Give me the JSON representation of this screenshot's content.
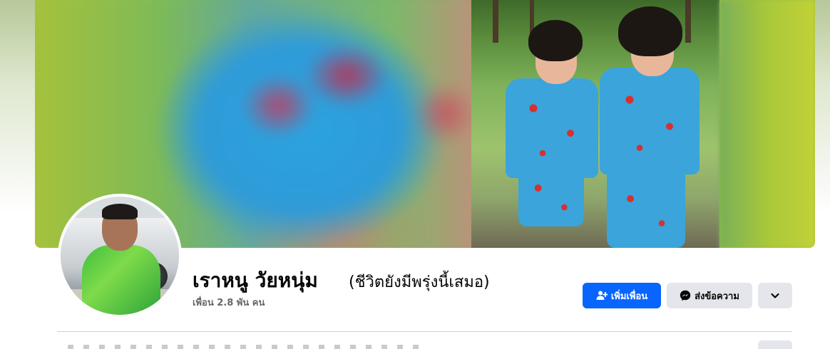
{
  "profile": {
    "name": "เราหนู วัยหนุ่ม",
    "alternate_name": "(ชีวิตยังมีพรุ่งนี้เสมอ)",
    "friends_count": "เพื่อน 2.8 พัน คน"
  },
  "actions": {
    "add_friend_label": "เพิ่มเพื่อน",
    "message_label": "ส่งข้อความ",
    "more_icon": "chevron-down-icon"
  },
  "icons": {
    "add_friend_icon": "person-plus-icon",
    "message_icon": "messenger-icon"
  },
  "colors": {
    "primary": "#0866ff",
    "secondary_button": "#e4e6eb",
    "text": "#050505",
    "muted_text": "#65676b"
  }
}
